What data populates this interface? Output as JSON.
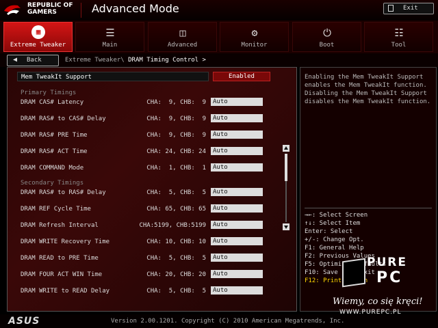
{
  "header": {
    "brand_line1": "REPUBLIC OF",
    "brand_line2": "GAMERS",
    "mode_title": "Advanced Mode",
    "exit_label": "Exit"
  },
  "tabs": [
    {
      "label": "Extreme Tweaker",
      "icon": "chip-icon",
      "active": true
    },
    {
      "label": "Main",
      "icon": "list-icon"
    },
    {
      "label": "Advanced",
      "icon": "advanced-icon"
    },
    {
      "label": "Monitor",
      "icon": "monitor-icon"
    },
    {
      "label": "Boot",
      "icon": "power-icon"
    },
    {
      "label": "Tool",
      "icon": "tool-icon"
    }
  ],
  "nav": {
    "back_label": "Back",
    "breadcrumb_parent": "Extreme Tweaker\\",
    "breadcrumb_current": "DRAM Timing Control >"
  },
  "main": {
    "selected_item_label": "Mem TweakIt Support",
    "selected_item_value": "Enabled",
    "section_primary": "Primary Timings",
    "section_secondary": "Secondary Timings",
    "rows": [
      {
        "label": "DRAM CAS# Latency",
        "value": "CHA:  9, CHB:  9",
        "setting": "Auto"
      },
      {
        "label": "DRAM RAS# to CAS# Delay",
        "value": "CHA:  9, CHB:  9",
        "setting": "Auto"
      },
      {
        "label": "DRAM RAS# PRE Time",
        "value": "CHA:  9, CHB:  9",
        "setting": "Auto"
      },
      {
        "label": "DRAM RAS# ACT Time",
        "value": "CHA: 24, CHB: 24",
        "setting": "Auto"
      },
      {
        "label": "DRAM COMMAND Mode",
        "value": "CHA:  1, CHB:  1",
        "setting": "Auto"
      },
      {
        "label": "DRAM RAS# to RAS# Delay",
        "value": "CHA:  5, CHB:  5",
        "setting": "Auto"
      },
      {
        "label": "DRAM REF Cycle Time",
        "value": "CHA: 65, CHB: 65",
        "setting": "Auto"
      },
      {
        "label": "DRAM Refresh Interval",
        "value": "CHA:5199, CHB:5199",
        "setting": "Auto"
      },
      {
        "label": "DRAM WRITE Recovery Time",
        "value": "CHA: 10, CHB: 10",
        "setting": "Auto"
      },
      {
        "label": "DRAM READ to PRE Time",
        "value": "CHA:  5, CHB:  5",
        "setting": "Auto"
      },
      {
        "label": "DRAM FOUR ACT WIN Time",
        "value": "CHA: 20, CHB: 20",
        "setting": "Auto"
      },
      {
        "label": "DRAM WRITE to READ Delay",
        "value": "CHA:  5, CHB:  5",
        "setting": "Auto"
      }
    ]
  },
  "help": {
    "description": "Enabling the Mem TweakIt Support enables the Mem TweakIt function. Disabling the Mem TweakIt Support disables the Mem TweakIt function.",
    "keys": [
      "→←: Select Screen",
      "↑↓: Select Item",
      "Enter: Select",
      "+/-: Change Opt.",
      "F1: General Help",
      "F2: Previous Values",
      "F5: Optimized Defaults",
      "F10: Save  ESC: Exit",
      "F12: Print Screen"
    ]
  },
  "watermark": {
    "brand_top": "PURE",
    "brand_bottom": "PC",
    "slogan": "Wiemy, co się kręci!",
    "url": "WWW.PUREPC.PL"
  },
  "footer": {
    "logo": "ASUS",
    "version": "Version 2.00.1201. Copyright (C) 2010 American Megatrends, Inc."
  },
  "colors": {
    "accent": "#d41515",
    "highlight": "#ffd800"
  }
}
